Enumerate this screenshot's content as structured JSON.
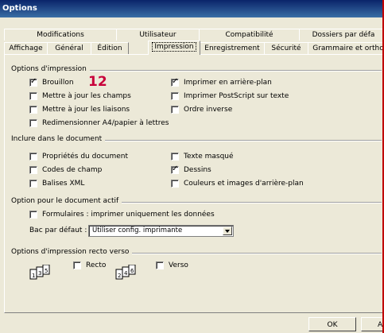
{
  "window": {
    "title": "Options"
  },
  "tabs_row1": [
    "Modifications",
    "Utilisateur",
    "Compatibilité",
    "Dossiers par défa"
  ],
  "tabs_row2": [
    "Affichage",
    "Général",
    "Édition",
    "Impression",
    "Enregistrement",
    "Sécurité",
    "Grammaire et ortho"
  ],
  "active_tab": "Impression",
  "print_options": {
    "label": "Options d'impression",
    "badge": "12",
    "items": [
      {
        "label": "Brouillon",
        "checked": true
      },
      {
        "label": "Mettre à jour les champs",
        "checked": false
      },
      {
        "label": "Mettre à jour les liaisons",
        "checked": false
      },
      {
        "label": "Redimensionner A4/papier à lettres",
        "checked": false
      },
      {
        "label": "Imprimer en arrière-plan",
        "checked": true
      },
      {
        "label": "Imprimer PostScript sur texte",
        "checked": false
      },
      {
        "label": "Ordre inverse",
        "checked": false
      }
    ]
  },
  "include": {
    "label": "Inclure dans le document",
    "items": [
      {
        "label": "Propriétés du document",
        "checked": false
      },
      {
        "label": "Codes de champ",
        "checked": false
      },
      {
        "label": "Balises XML",
        "checked": false
      },
      {
        "label": "Texte masqué",
        "checked": false
      },
      {
        "label": "Dessins",
        "checked": true
      },
      {
        "label": "Couleurs et images d'arrière-plan",
        "checked": false
      }
    ]
  },
  "active_doc": {
    "label": "Option pour le document actif",
    "forms_label": "Formulaires : imprimer uniquement les données",
    "forms_checked": false,
    "tray_label": "Bac par défaut :",
    "tray_value": "Utiliser config. imprimante"
  },
  "duplex": {
    "label": "Options d'impression recto verso",
    "recto_label": "Recto",
    "verso_label": "Verso",
    "recto_checked": false,
    "verso_checked": false
  },
  "buttons": {
    "ok": "OK",
    "cancel": "A"
  }
}
